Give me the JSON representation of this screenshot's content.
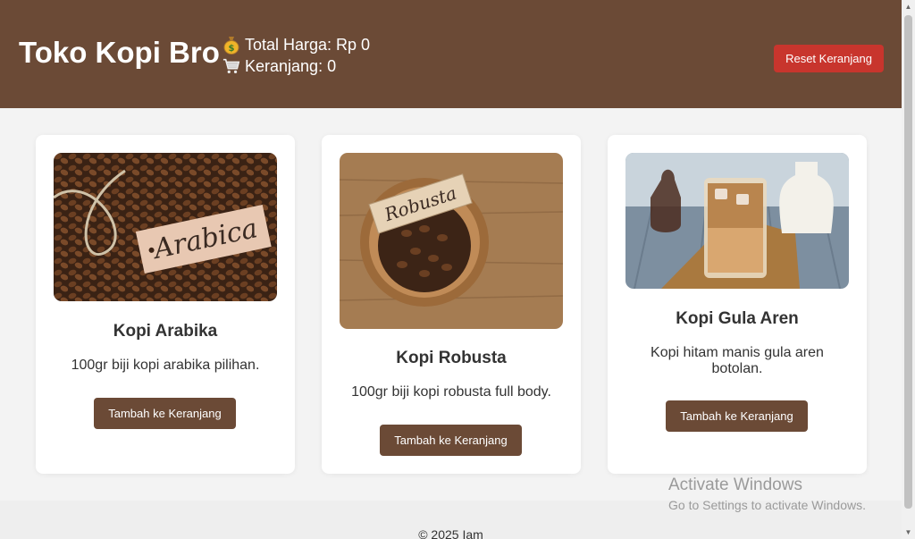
{
  "header": {
    "brand": "Toko Kopi Bro",
    "total_label": "Total Harga: Rp 0",
    "cart_label": "Keranjang: 0",
    "money_icon": "money-bag-icon",
    "cart_icon": "shopping-cart-icon",
    "reset_label": "Reset Keranjang"
  },
  "products": [
    {
      "name": "Kopi Arabika",
      "desc": "100gr biji kopi arabika pilihan.",
      "button": "Tambah ke Keranjang",
      "image_text": "Arabica"
    },
    {
      "name": "Kopi Robusta",
      "desc": "100gr biji kopi robusta full body.",
      "button": "Tambah ke Keranjang",
      "image_text": "Robusta"
    },
    {
      "name": "Kopi Gula Aren",
      "desc": "Kopi hitam manis gula aren botolan.",
      "button": "Tambah ke Keranjang"
    }
  ],
  "footer": {
    "copyright": "© 2025 Iam"
  },
  "watermark": {
    "title": "Activate Windows",
    "subtitle": "Go to Settings to activate Windows."
  },
  "colors": {
    "header_bg": "#6b4a36",
    "reset_bg": "#c8352d",
    "button_bg": "#6b4a36",
    "page_bg": "#f3f3f3"
  }
}
